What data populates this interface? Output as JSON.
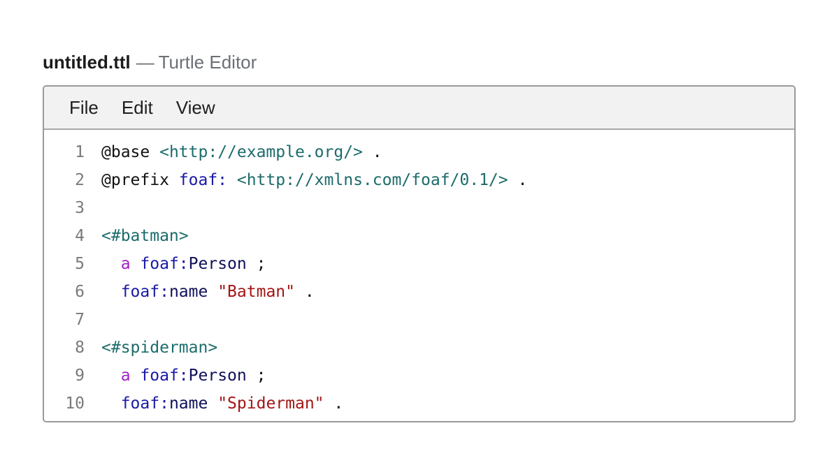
{
  "window": {
    "filename": "untitled.ttl",
    "separator": "—",
    "app_name": "Turtle Editor"
  },
  "menu": [
    {
      "label": "File"
    },
    {
      "label": "Edit"
    },
    {
      "label": "View"
    }
  ],
  "editor": {
    "lines": [
      {
        "number": "1",
        "tokens": [
          {
            "type": "kw",
            "text": "@base"
          },
          {
            "type": "ws",
            "text": " "
          },
          {
            "type": "iri",
            "text": "<http://example.org/>"
          },
          {
            "type": "ws",
            "text": " "
          },
          {
            "type": "punct",
            "text": "."
          }
        ]
      },
      {
        "number": "2",
        "tokens": [
          {
            "type": "kw",
            "text": "@prefix"
          },
          {
            "type": "ws",
            "text": " "
          },
          {
            "type": "pfx",
            "text": "foaf:"
          },
          {
            "type": "ws",
            "text": " "
          },
          {
            "type": "iri",
            "text": "<http://xmlns.com/foaf/0.1/>"
          },
          {
            "type": "ws",
            "text": " "
          },
          {
            "type": "punct",
            "text": "."
          }
        ]
      },
      {
        "number": "3",
        "tokens": []
      },
      {
        "number": "4",
        "tokens": [
          {
            "type": "iri",
            "text": "<#batman>"
          }
        ]
      },
      {
        "number": "5",
        "tokens": [
          {
            "type": "ws",
            "text": "  "
          },
          {
            "type": "a",
            "text": "a"
          },
          {
            "type": "ws",
            "text": " "
          },
          {
            "type": "pfx",
            "text": "foaf:"
          },
          {
            "type": "local",
            "text": "Person"
          },
          {
            "type": "ws",
            "text": " "
          },
          {
            "type": "punct",
            "text": ";"
          }
        ]
      },
      {
        "number": "6",
        "tokens": [
          {
            "type": "ws",
            "text": "  "
          },
          {
            "type": "pfx",
            "text": "foaf:"
          },
          {
            "type": "local",
            "text": "name"
          },
          {
            "type": "ws",
            "text": " "
          },
          {
            "type": "str",
            "text": "\"Batman\""
          },
          {
            "type": "ws",
            "text": " "
          },
          {
            "type": "punct",
            "text": "."
          }
        ]
      },
      {
        "number": "7",
        "tokens": []
      },
      {
        "number": "8",
        "tokens": [
          {
            "type": "iri",
            "text": "<#spiderman>"
          }
        ]
      },
      {
        "number": "9",
        "tokens": [
          {
            "type": "ws",
            "text": "  "
          },
          {
            "type": "a",
            "text": "a"
          },
          {
            "type": "ws",
            "text": " "
          },
          {
            "type": "pfx",
            "text": "foaf:"
          },
          {
            "type": "local",
            "text": "Person"
          },
          {
            "type": "ws",
            "text": " "
          },
          {
            "type": "punct",
            "text": ";"
          }
        ]
      },
      {
        "number": "10",
        "tokens": [
          {
            "type": "ws",
            "text": "  "
          },
          {
            "type": "pfx",
            "text": "foaf:"
          },
          {
            "type": "local",
            "text": "name"
          },
          {
            "type": "ws",
            "text": " "
          },
          {
            "type": "str",
            "text": "\"Spiderman\""
          },
          {
            "type": "ws",
            "text": " "
          },
          {
            "type": "punct",
            "text": "."
          }
        ]
      }
    ]
  }
}
